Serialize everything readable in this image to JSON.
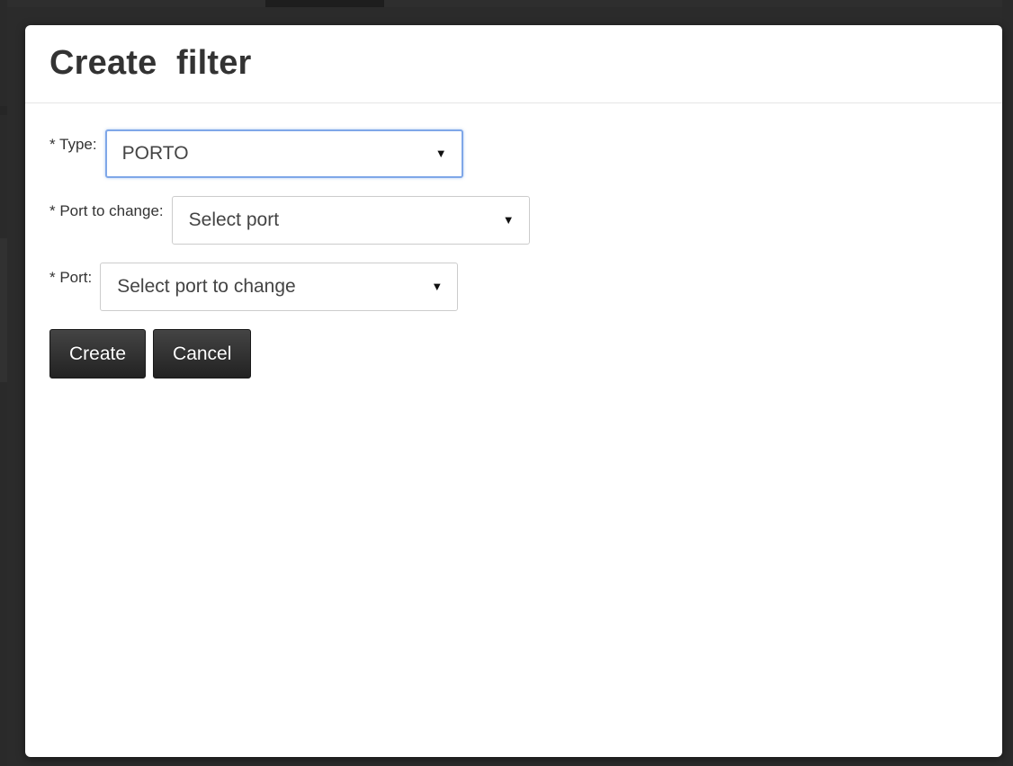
{
  "modal": {
    "title": "Create  filter"
  },
  "form": {
    "type": {
      "label": "* Type:",
      "selected": "PORTO"
    },
    "port_to_change": {
      "label": "* Port to change:",
      "selected": "Select port"
    },
    "port": {
      "label": "* Port:",
      "selected": "Select port to change"
    }
  },
  "buttons": {
    "create_label": "Create",
    "cancel_label": "Cancel"
  },
  "colors": {
    "button_bg": "#2a2a2a",
    "focus_border": "#7fa7e8",
    "text": "#333333"
  },
  "icons": {
    "dropdown": "caret-down-icon"
  }
}
